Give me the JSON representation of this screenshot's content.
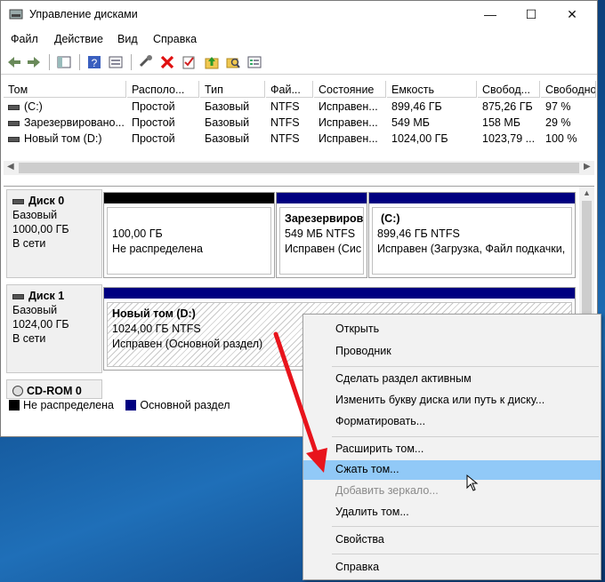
{
  "window": {
    "title": "Управление дисками"
  },
  "menubar": [
    "Файл",
    "Действие",
    "Вид",
    "Справка"
  ],
  "table": {
    "columns": [
      "Том",
      "Располо...",
      "Тип",
      "Фай...",
      "Состояние",
      "Емкость",
      "Свобод...",
      "Свободно"
    ],
    "rows": [
      [
        "(C:)",
        "Простой",
        "Базовый",
        "NTFS",
        "Исправен...",
        "899,46 ГБ",
        "875,26 ГБ",
        "97 %"
      ],
      [
        "Зарезервировано...",
        "Простой",
        "Базовый",
        "NTFS",
        "Исправен...",
        "549 МБ",
        "158 МБ",
        "29 %"
      ],
      [
        "Новый том (D:)",
        "Простой",
        "Базовый",
        "NTFS",
        "Исправен...",
        "1024,00 ГБ",
        "1023,79 ...",
        "100 %"
      ]
    ]
  },
  "disks": [
    {
      "name": "Диск 0",
      "type": "Базовый",
      "size": "1000,00 ГБ",
      "status": "В сети",
      "partitions": [
        {
          "title": "",
          "size": "100,00 ГБ",
          "status": "Не распределена"
        },
        {
          "title": "Зарезервиров",
          "size": "549 МБ NTFS",
          "status": "Исправен (Сис"
        },
        {
          "title": "(C:)",
          "size": "899,46 ГБ NTFS",
          "status": "Исправен (Загрузка, Файл подкачки,"
        }
      ]
    },
    {
      "name": "Диск 1",
      "type": "Базовый",
      "size": "1024,00 ГБ",
      "status": "В сети",
      "partitions": [
        {
          "title": "Новый том  (D:)",
          "size": "1024,00 ГБ NTFS",
          "status": "Исправен (Основной раздел)"
        }
      ]
    },
    {
      "name": "CD-ROM 0"
    }
  ],
  "legend": [
    {
      "label": "Не распределена",
      "color": "#000000"
    },
    {
      "label": "Основной раздел",
      "color": "#000080"
    }
  ],
  "context_menu": {
    "items": [
      "Открыть",
      "Проводник",
      "Сделать раздел активным",
      "Изменить букву диска или путь к диску...",
      "Форматировать...",
      "Расширить том...",
      "Сжать том...",
      "Добавить зеркало...",
      "Удалить том...",
      "Свойства",
      "Справка"
    ]
  },
  "colors": {
    "primary_partition": "#000080",
    "unallocated": "#000000",
    "menu_highlight": "#91c9f7",
    "arrow": "#e8141c"
  }
}
